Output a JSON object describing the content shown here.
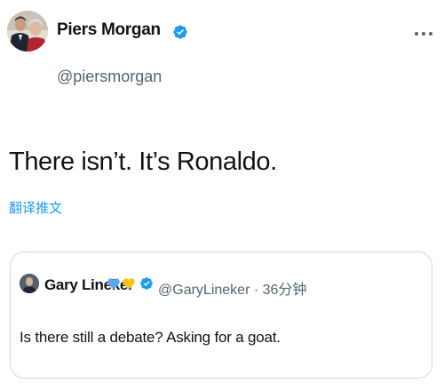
{
  "tweet": {
    "author_name": "Piers Morgan",
    "author_handle": "@piersmorgan",
    "text": "There isn’t. It’s Ronaldo.",
    "translate_label": "翻译推文"
  },
  "quote": {
    "author_name": "Gary Lineker",
    "handle": "@GaryLineker",
    "separator": "·",
    "time": "36分钟",
    "text": "Is there still a debate? Asking for a goat."
  },
  "icons": {
    "verified": "verified-badge-icon",
    "more": "more-options-icon",
    "heart_blue": "blue-heart-icon",
    "heart_yellow": "yellow-heart-icon"
  },
  "colors": {
    "accent_blue": "#1d9bf0",
    "heart_blue": "#5aa9f0",
    "heart_yellow": "#f5c518",
    "secondary_text": "#536471",
    "border": "#cfd9de"
  }
}
